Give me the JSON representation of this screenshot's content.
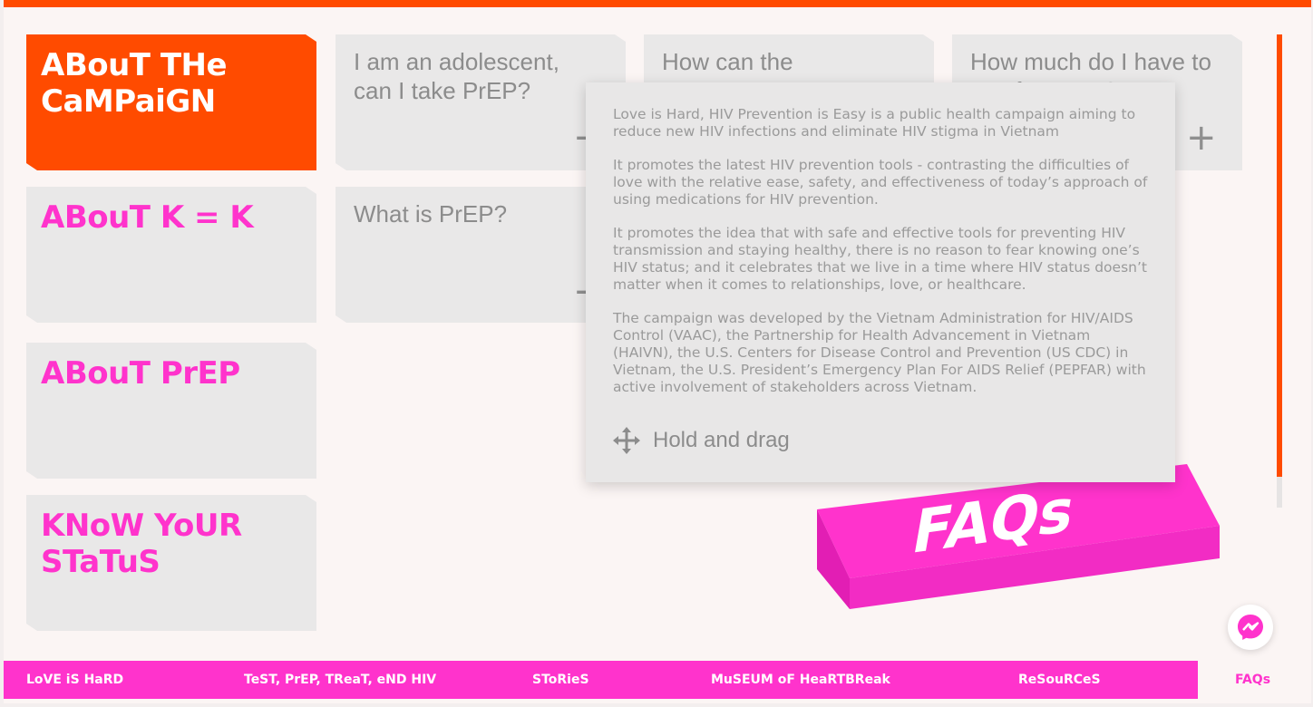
{
  "categories": [
    {
      "label": "ABouT THe CaMPaiGN",
      "active": true
    },
    {
      "label": "ABouT K = K"
    },
    {
      "label": "ABouT PrEP"
    },
    {
      "label": "KNoW YoUR STaTuS"
    }
  ],
  "questions": [
    {
      "text": "I am an adolescent, can I take PrEP?"
    },
    {
      "text": "How can the"
    },
    {
      "text": "How much do I have to pay for PrEP?"
    },
    {
      "text": "What is PrEP?"
    }
  ],
  "popup": {
    "paragraphs": [
      "Love is Hard, HIV Prevention is Easy is a public health campaign aiming to reduce new HIV infections and eliminate HIV stigma in Vietnam",
      "It promotes the latest HIV prevention tools - contrasting the difficulties of love with the relative ease, safety, and effectiveness of today’s approach of using medications for HIV prevention.",
      "It promotes the idea that with safe and effective tools for preventing HIV transmission and staying healthy, there is no reason to fear knowing one’s HIV status; and it celebrates that we live in a time where HIV status doesn’t matter when it comes to relationships, love, or healthcare.",
      "The campaign was developed by the Vietnam Administration for HIV/AIDS Control (VAAC), the Partnership for Health Advancement in Vietnam (HAIVN), the U.S. Centers for Disease Control and Prevention (US CDC) in Vietnam, the U.S. President’s Emergency Plan For AIDS Relief (PEPFAR) with active involvement of stakeholders across Vietnam."
    ],
    "drag_label": "Hold and drag",
    "drag_icon": "move-arrows-icon"
  },
  "faqs_block_label": "FAQs",
  "nav": [
    {
      "label": "LoVE iS HaRD"
    },
    {
      "label": "TeST, PrEP, TReaT, eND HIV"
    },
    {
      "label": "SToRieS"
    },
    {
      "label": "MuSEUM oF HeaRTBReak"
    },
    {
      "label": "ReSouRCeS"
    },
    {
      "label": "FAQs",
      "active": true
    }
  ],
  "colors": {
    "orange": "#ff4b00",
    "magenta": "#ff33cc",
    "card_gray": "#e9e8e8",
    "background": "#fbf5f4"
  },
  "icons": {
    "plus": "plus-icon",
    "messenger": "messenger-icon"
  }
}
